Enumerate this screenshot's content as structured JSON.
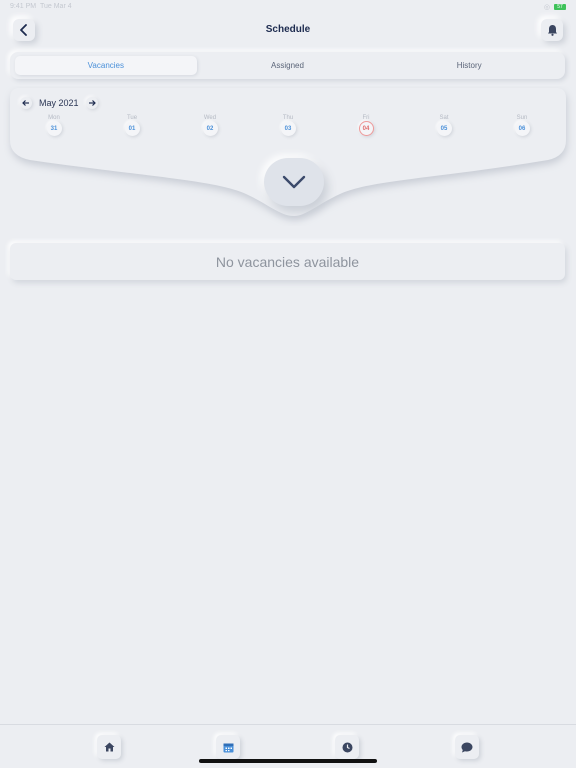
{
  "status_bar": {
    "time": "9:41 PM",
    "date": "Tue Mar 4",
    "battery": "57"
  },
  "header": {
    "title": "Schedule",
    "back_icon": "chevron-left-icon",
    "bell_icon": "bell-icon"
  },
  "tabs": [
    {
      "label": "Vacancies",
      "active": true
    },
    {
      "label": "Assigned",
      "active": false
    },
    {
      "label": "History",
      "active": false
    }
  ],
  "calendar": {
    "month": "May 2021",
    "days": [
      {
        "name": "Mon",
        "num": "31",
        "today": false
      },
      {
        "name": "Tue",
        "num": "01",
        "today": false
      },
      {
        "name": "Wed",
        "num": "02",
        "today": false
      },
      {
        "name": "Thu",
        "num": "03",
        "today": false
      },
      {
        "name": "Fri",
        "num": "04",
        "today": true
      },
      {
        "name": "Sat",
        "num": "05",
        "today": false
      },
      {
        "name": "Sun",
        "num": "06",
        "today": false
      }
    ]
  },
  "empty_state": {
    "message": "No vacancies available"
  },
  "nav": [
    {
      "icon": "home-icon",
      "active": false
    },
    {
      "icon": "calendar-icon",
      "active": true
    },
    {
      "icon": "clock-icon",
      "active": false
    },
    {
      "icon": "chat-icon",
      "active": false
    }
  ],
  "colors": {
    "accent": "#4a90d9",
    "today": "#e06b6b",
    "background": "#eceef2",
    "text": "#1d2b4f"
  }
}
